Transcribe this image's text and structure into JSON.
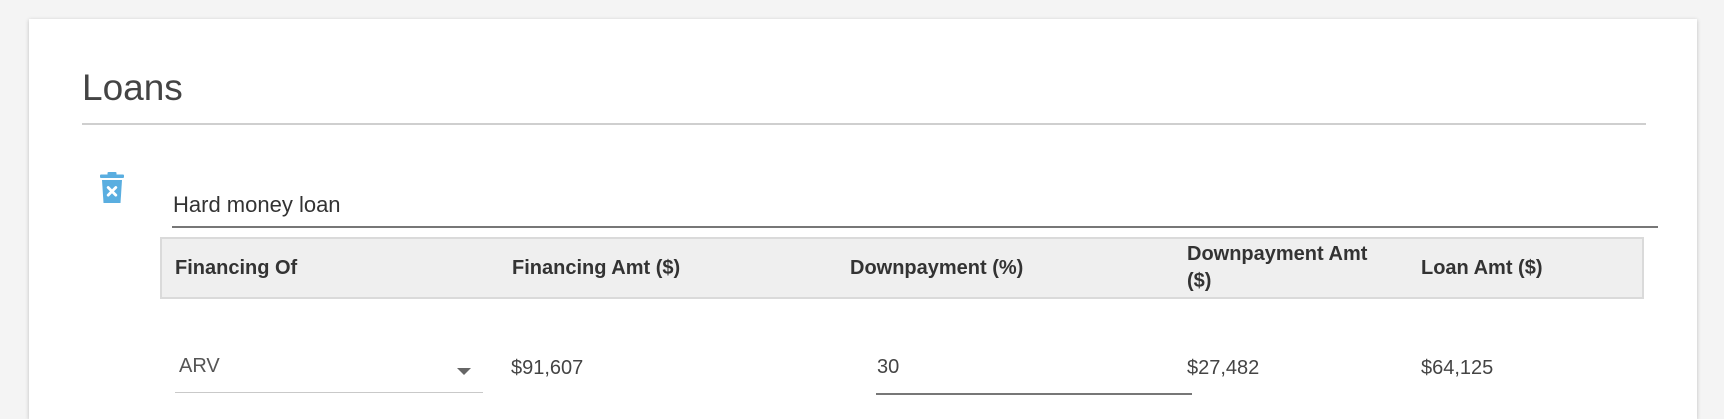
{
  "section": {
    "title": "Loans"
  },
  "loan": {
    "name_value": "Hard money loan",
    "delete_icon": "trash-x-icon",
    "accent_color": "#5aaee0"
  },
  "table": {
    "headers": [
      "Financing Of",
      "Financing Amt ($)",
      "Downpayment (%)",
      "Downpayment Amt ($)",
      "Loan Amt ($)"
    ],
    "row": {
      "financing_of": "ARV",
      "financing_amt": "$91,607",
      "downpayment_pct": "30",
      "downpayment_amt": "$27,482",
      "loan_amt": "$64,125"
    }
  }
}
